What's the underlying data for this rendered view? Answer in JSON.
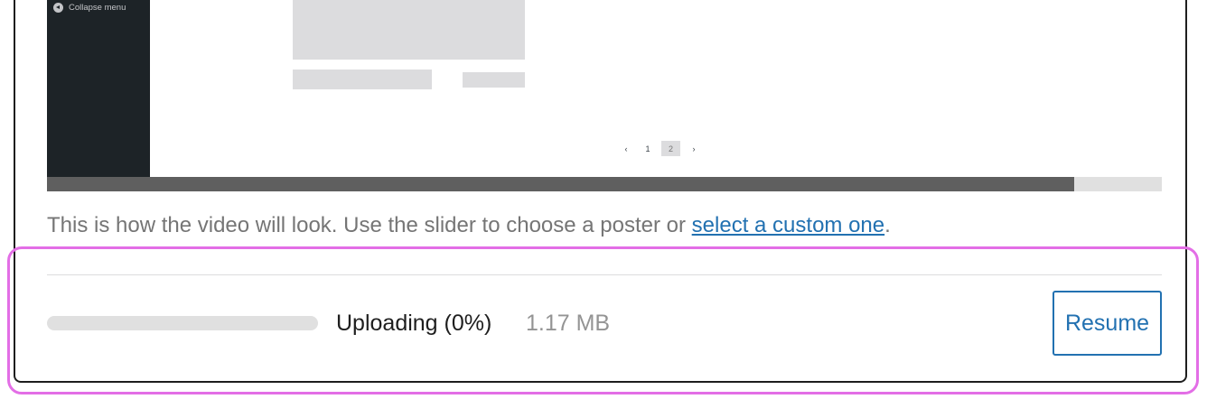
{
  "preview": {
    "sidebar": {
      "collapse_label": "Collapse menu",
      "collapse_icon": "arrow-left-circle-icon"
    },
    "pagination": {
      "prev_icon": "chevron-left-icon",
      "pages": [
        "1",
        "2"
      ],
      "current_page": "2",
      "next_icon": "chevron-right-icon"
    }
  },
  "scrubber": {
    "position_fraction": 0.921
  },
  "caption": {
    "text": "This is how the video will look. Use the slider to choose a poster or ",
    "link_text": "select a custom one",
    "suffix": "."
  },
  "upload": {
    "status": "Uploading (0%)",
    "size": "1.17 MB",
    "progress_fraction": 0.0
  },
  "buttons": {
    "resume_label": "Resume"
  },
  "colors": {
    "accent": "#2271b1",
    "highlight": "#e36ee6",
    "sidebar": "#1d2327"
  }
}
